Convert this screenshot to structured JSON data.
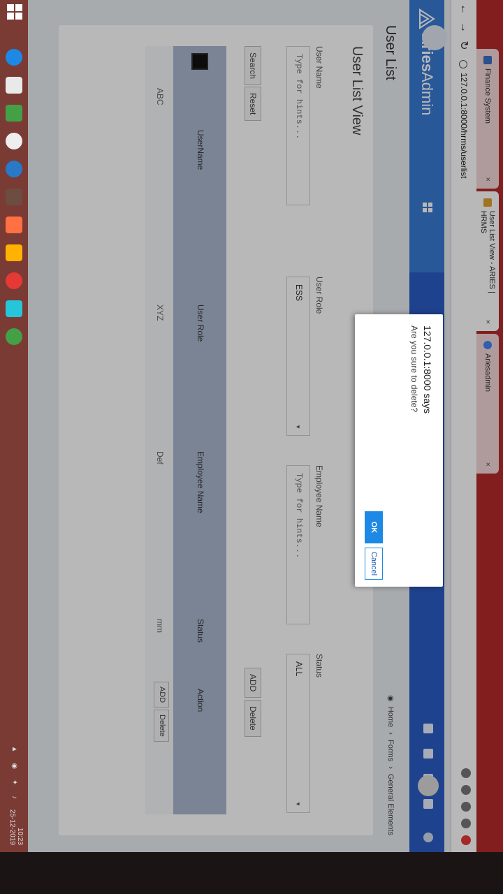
{
  "browser": {
    "tabs": [
      {
        "title": "Finance System",
        "close": "×"
      },
      {
        "title": "User List View - ARIES | HRMS",
        "close": "×"
      },
      {
        "title": "Ariesadmin",
        "close": "×"
      }
    ],
    "url": "127.0.0.1:8000/hrms/userlist"
  },
  "header": {
    "brand_bold": "Aries",
    "brand_light": "Admin"
  },
  "page": {
    "title": "User List",
    "breadcrumb": [
      "Home",
      "Forms",
      "General Elements"
    ]
  },
  "card": {
    "title": "User List View",
    "fields": {
      "user_name_label": "User Name",
      "user_name_placeholder": "Type for hints...",
      "user_role_label": "User Role",
      "user_role_value": "ESS",
      "employee_name_label": "Employee Name",
      "employee_name_placeholder": "Type for hints...",
      "status_label": "Status",
      "status_value": "ALL"
    },
    "buttons": {
      "search": "Search",
      "reset": "Reset",
      "add": "ADD",
      "delete": "Delete"
    }
  },
  "table": {
    "headers": [
      "UserName",
      "User Role",
      "Employee Name",
      "Status",
      "Action"
    ],
    "rows": [
      {
        "username": "ABC",
        "role": "XYZ",
        "employee": "Def",
        "status": "mm",
        "add": "ADD",
        "delete": "Delete"
      }
    ]
  },
  "dialog": {
    "title": "127.0.0.1:8000 says",
    "message": "Are you sure to delete?",
    "ok": "OK",
    "cancel": "Cancel"
  },
  "taskbar": {
    "time": "10:23",
    "date": "25-12-2019"
  }
}
